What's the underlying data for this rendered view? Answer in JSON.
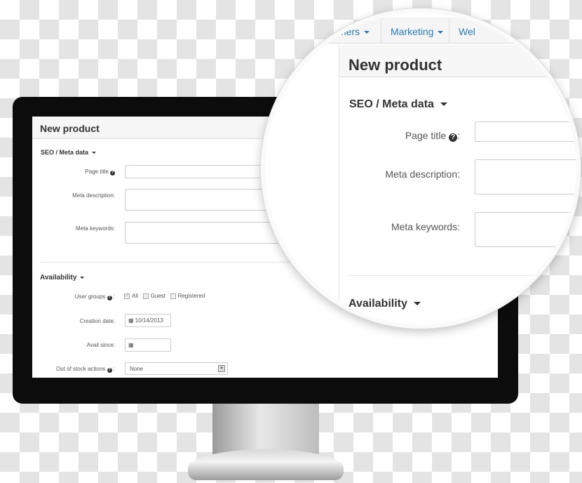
{
  "nav": {
    "items": [
      {
        "label": "mers"
      },
      {
        "label": "Marketing"
      },
      {
        "label": "Wel"
      }
    ]
  },
  "page": {
    "title": "New product"
  },
  "seo": {
    "heading": "SEO / Meta data",
    "page_title_label": "Page title",
    "meta_description_label": "Meta description:",
    "meta_keywords_label": "Meta keywords:",
    "colon": ":"
  },
  "availability": {
    "heading": "Availability",
    "user_groups_label": "User groups",
    "groups": [
      {
        "label": "All",
        "checked": true
      },
      {
        "label": "Guest",
        "checked": false
      },
      {
        "label": "Registered",
        "checked": false
      }
    ],
    "creation_date_label": "Creation date:",
    "creation_date": "10/14/2013",
    "avail_since_label": "Avail since:",
    "avail_since": "",
    "out_of_stock_label": "Out of stock actions",
    "out_of_stock_value": "None"
  },
  "colors": {
    "accent": "#2a7ab8",
    "bezel": "#0c0c0c"
  }
}
